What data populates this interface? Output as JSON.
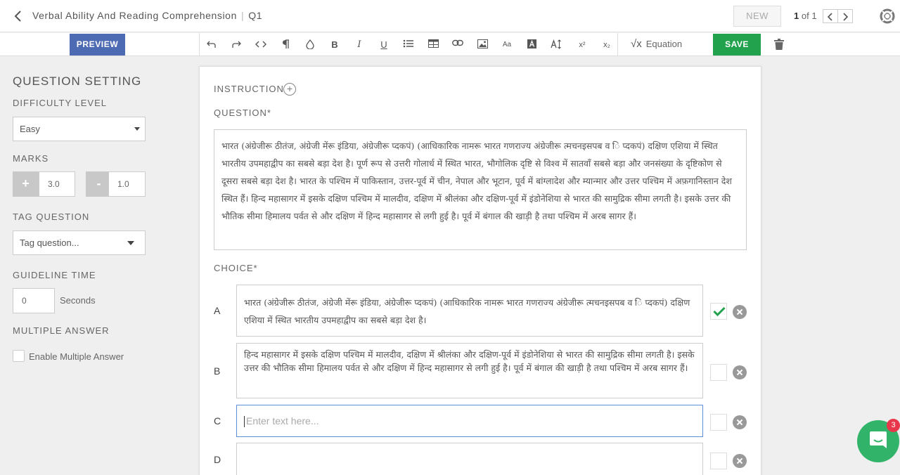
{
  "header": {
    "title": "Verbal Ability And Reading Comprehension",
    "question_id": "Q1",
    "new_label": "NEW",
    "page_current": "1",
    "page_total_text": "of 1"
  },
  "toolbar": {
    "preview_label": "PREVIEW",
    "equation_label": "Equation",
    "save_label": "SAVE",
    "text_size_glyph": "Aa",
    "superscript_glyph": "x²",
    "subscript_glyph": "x₂"
  },
  "sidebar": {
    "heading": "QUESTION SETTING",
    "difficulty_label": "DIFFICULTY LEVEL",
    "difficulty_value": "Easy",
    "marks_label": "MARKS",
    "marks_plus_symbol": "+",
    "marks_plus_value": "3.0",
    "marks_minus_symbol": "-",
    "marks_minus_value": "1.0",
    "tag_label": "TAG QUESTION",
    "tag_placeholder": "Tag question...",
    "guideline_label": "GUIDELINE TIME",
    "guideline_value": "0",
    "guideline_unit": "Seconds",
    "multiple_label": "MULTIPLE ANSWER",
    "multiple_checkbox_label": "Enable Multiple Answer"
  },
  "main": {
    "instruction_label": "INSTRUCTION",
    "question_label": "QUESTION*",
    "question_text": "भारत (अंग्रेजीरू ठीतंज, अंग्रेजी मेंरू इंडिया, अंग्रेजीरू प्दकपं) (आधिकारिक नामरू भारत गणराज्य अंग्रेजीरू त्मचनइसपब व ि प्दकपं) दक्षिण एशिया में स्थित भारतीय उपमहाद्वीप का सबसे बड़ा देश है। पूर्ण रूप से उत्तरी गोलार्ध में स्थित भारत, भौगोलिक दृष्टि से विश्व में सातवाँ सबसे बड़ा और जनसंख्या के दृष्टिकोण से दूसरा सबसे बड़ा देश है। भारत के पश्चिम में पाकिस्तान, उत्तर-पूर्व में चीन, नेपाल और भूटान, पूर्व में बांग्लादेश और म्यान्मार और उत्तर पश्चिम में अफ़गानिस्तान देश स्थित हैं। हिन्द महासागर में इसके दक्षिण पश्चिम में मालदीव, दक्षिण में श्रीलंका और दक्षिण-पूर्व में इंडोनेशिया से भारत की सामुद्रिक सीमा लगती है। इसके उत्तर की भौतिक सीमा हिमालय पर्वत से और दक्षिण में हिन्द महासागर से लगी हुई है। पूर्व में बंगाल की खाड़ी है तथा पश्चिम में अरब सागर हैं।",
    "choice_label": "CHOICE*",
    "choices": [
      {
        "letter": "A",
        "text": "भारत (अंग्रेजीरू ठीतंज, अंग्रेजी मेंरू इंडिया, अंग्रेजीरू प्दकपं) (आधिकारिक नामरू भारत गणराज्य अंग्रेजीरू त्मचनइसपब व ि प्दकपं) दक्षिण एशिया में स्थित भारतीय उपमहाद्वीप का सबसे बड़ा देश है।",
        "checked": true
      },
      {
        "letter": "B",
        "text": "हिन्द महासागर में इसके दक्षिण पश्चिम में मालदीव, दक्षिण में श्रीलंका और दक्षिण-पूर्व में इंडोनेशिया से भारत की सामुद्रिक सीमा लगती है। इसके उत्तर की भौतिक सीमा हिमालय पर्वत से और दक्षिण में हिन्द महासागर से लगी हुई है। पूर्व में बंगाल की खाड़ी है तथा पश्चिम में अरब सागर हैं।",
        "checked": false
      },
      {
        "letter": "C",
        "text": "",
        "placeholder": "Enter text here...",
        "checked": false
      },
      {
        "letter": "D",
        "text": "",
        "checked": false
      }
    ]
  },
  "chat": {
    "badge_count": "3"
  },
  "colors": {
    "accent_blue": "#4d6bb3",
    "save_green": "#23a24d",
    "check_green": "#23a24d",
    "badge_red": "#e8374a"
  }
}
